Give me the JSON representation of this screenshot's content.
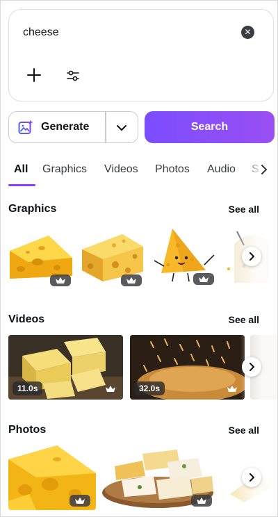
{
  "search": {
    "query": "cheese",
    "clear_icon": "close-circle-icon",
    "add_icon": "plus-icon",
    "filter_icon": "sliders-icon"
  },
  "actions": {
    "generate_label": "Generate",
    "generate_icon": "sparkle-image-icon",
    "dropdown_icon": "chevron-down-icon",
    "search_label": "Search"
  },
  "tabs": {
    "items": [
      "All",
      "Graphics",
      "Videos",
      "Photos",
      "Audio",
      "S"
    ],
    "selected": "All",
    "more_icon": "chevron-right-icon"
  },
  "sections": {
    "graphics": {
      "title": "Graphics",
      "see_all": "See all"
    },
    "videos": {
      "title": "Videos",
      "see_all": "See all",
      "durations": [
        "11.0s",
        "32.0s"
      ]
    },
    "photos": {
      "title": "Photos",
      "see_all": "See all"
    }
  },
  "colors": {
    "accent": "#8b3dff",
    "search_gradient_start": "#7b4dff",
    "search_gradient_end": "#9a4ff3",
    "premium_badge": "#3c3c42"
  }
}
